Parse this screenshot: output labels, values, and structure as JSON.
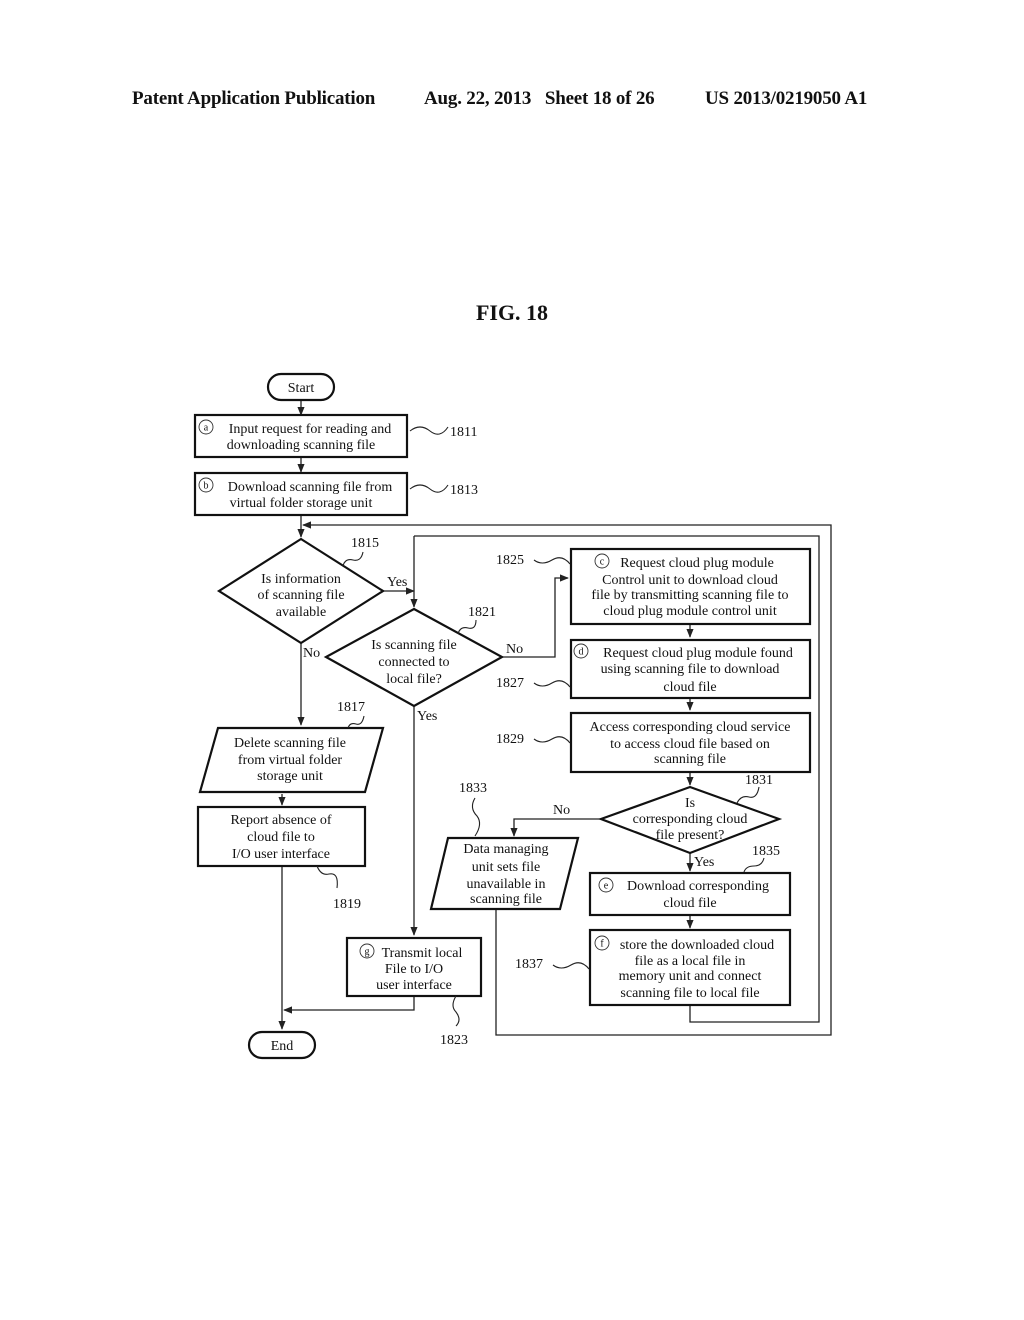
{
  "header": {
    "publication": "Patent Application Publication",
    "date_sheet": "Aug. 22, 2013   Sheet 18 of 26",
    "patent_number": "US 2013/0219050 A1"
  },
  "figure": {
    "title": "FIG. 18"
  },
  "nodes": {
    "start": {
      "label": "Start"
    },
    "end": {
      "label": "End"
    },
    "n1811": {
      "ref": "1811",
      "marker": "a",
      "lines": [
        "Input request for reading and",
        "downloading scanning file"
      ]
    },
    "n1813": {
      "ref": "1813",
      "marker": "b",
      "lines": [
        "Download scanning file from",
        "virtual folder storage unit"
      ]
    },
    "n1815": {
      "ref": "1815",
      "lines": [
        "Is information",
        "of scanning file",
        "available"
      ]
    },
    "n1817": {
      "ref": "1817",
      "lines": [
        "Delete scanning file",
        "from virtual folder",
        "storage unit"
      ]
    },
    "n1819": {
      "ref": "1819",
      "lines": [
        "Report absence of",
        "cloud file to",
        "I/O user interface"
      ]
    },
    "n1821": {
      "ref": "1821",
      "lines": [
        "Is scanning file",
        "connected to",
        "local file?"
      ]
    },
    "n1823": {
      "ref": "1823",
      "marker": "g",
      "lines": [
        "Transmit local",
        "File to I/O",
        "user interface"
      ]
    },
    "n1825": {
      "ref": "1825",
      "marker": "c",
      "lines": [
        "Request cloud plug module",
        "Control unit to download cloud",
        "file by transmitting scanning file to",
        "cloud plug module control unit"
      ]
    },
    "n1827": {
      "ref": "1827",
      "marker": "d",
      "lines": [
        "Request cloud plug module found",
        "using scanning file to download",
        "cloud file"
      ]
    },
    "n1829": {
      "ref": "1829",
      "lines": [
        "Access corresponding cloud service",
        "to access cloud file based on",
        "scanning file"
      ]
    },
    "n1831": {
      "ref": "1831",
      "lines": [
        "Is",
        "corresponding cloud",
        "file present?"
      ]
    },
    "n1833": {
      "ref": "1833",
      "lines": [
        "Data managing",
        "unit sets file",
        "unavailable in",
        "scanning file"
      ]
    },
    "n1835": {
      "ref": "1835",
      "marker": "e",
      "lines": [
        "Download corresponding",
        "cloud file"
      ]
    },
    "n1837": {
      "ref": "1837",
      "marker": "f",
      "lines": [
        "store the downloaded cloud",
        "file as a local file in",
        "memory unit and connect",
        "scanning file to local file"
      ]
    }
  },
  "edge_labels": {
    "e1815_yes": "Yes",
    "e1815_no": "No",
    "e1821_no": "No",
    "e1821_yes": "Yes",
    "e1831_no": "No",
    "e1831_yes": "Yes"
  }
}
